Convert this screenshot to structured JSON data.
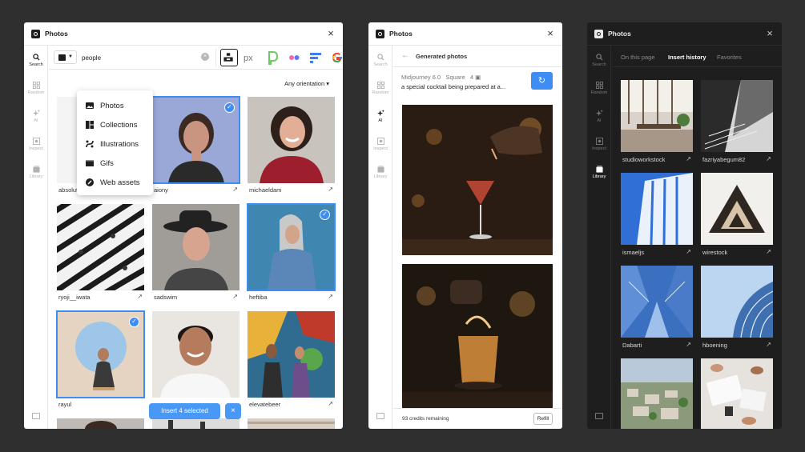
{
  "panel1": {
    "title": "Photos",
    "rail": [
      {
        "label": "Search",
        "icon": "search-icon",
        "active": true
      },
      {
        "label": "Random",
        "icon": "grid-icon"
      },
      {
        "label": "AI",
        "icon": "sparkle-icon"
      },
      {
        "label": "Inspect",
        "icon": "inspect-icon"
      },
      {
        "label": "Library",
        "icon": "library-icon"
      }
    ],
    "search_value": "people",
    "orientation": "Any orientation",
    "dropdown": [
      "Photos",
      "Collections",
      "Illustrations",
      "Gifs",
      "Web assets"
    ],
    "photos": [
      {
        "author": "absolut",
        "selected": false
      },
      {
        "author": "aiony",
        "selected": true
      },
      {
        "author": "michaeldam",
        "selected": false
      },
      {
        "author": "ryoji__iwata",
        "selected": false
      },
      {
        "author": "sadswim",
        "selected": false
      },
      {
        "author": "heftiba",
        "selected": true
      },
      {
        "author": "rayul",
        "selected": true
      },
      {
        "author": "",
        "selected": false
      },
      {
        "author": "elevatebeer",
        "selected": false
      }
    ],
    "insert_label": "Insert 4 selected"
  },
  "panel2": {
    "title": "Photos",
    "rail": [
      {
        "label": "Search",
        "icon": "search-icon"
      },
      {
        "label": "Random",
        "icon": "grid-icon"
      },
      {
        "label": "AI",
        "icon": "sparkle-icon",
        "active": true
      },
      {
        "label": "Inspect",
        "icon": "inspect-icon"
      },
      {
        "label": "Library",
        "icon": "library-icon"
      }
    ],
    "header": "Generated photos",
    "model": "Midjourney 6.0",
    "shape": "Square",
    "count": "4",
    "prompt": "a special cocktail being prepared at a...",
    "credits": "93 credits remaining",
    "refill": "Refill"
  },
  "panel3": {
    "title": "Photos",
    "rail": [
      {
        "label": "Search",
        "icon": "search-icon"
      },
      {
        "label": "Random",
        "icon": "grid-icon"
      },
      {
        "label": "AI",
        "icon": "sparkle-icon"
      },
      {
        "label": "Inspect",
        "icon": "inspect-icon"
      },
      {
        "label": "Library",
        "icon": "library-icon",
        "active": true
      }
    ],
    "tabs": [
      "On this page",
      "Insert history",
      "Favorites"
    ],
    "active_tab": 1,
    "photos": [
      {
        "author": "studioworkstock"
      },
      {
        "author": "fazriyabegum82"
      },
      {
        "author": "ismaeljs"
      },
      {
        "author": "wirestock"
      },
      {
        "author": "Dabarti"
      },
      {
        "author": "hboening"
      },
      {
        "author": ""
      },
      {
        "author": ""
      }
    ]
  },
  "colors": {
    "accent": "#3d8df5",
    "background": "#2f2f2f",
    "dark_panel": "#1e1e1e"
  }
}
